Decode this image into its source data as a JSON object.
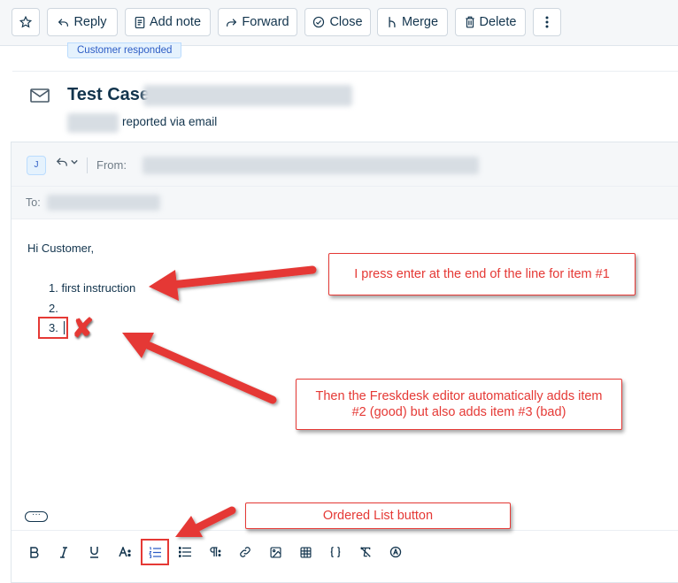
{
  "toolbar": {
    "reply_label": "Reply",
    "add_note_label": "Add note",
    "forward_label": "Forward",
    "close_label": "Close",
    "merge_label": "Merge",
    "delete_label": "Delete"
  },
  "ticket": {
    "status_badge": "Customer responded",
    "title": "Test Case",
    "source_text": "reported via email"
  },
  "editor": {
    "avatar_initial": "J",
    "from_label": "From:",
    "to_label": "To:",
    "greeting": "Hi Customer,",
    "list_items": [
      "1. first instruction",
      "2.",
      "3."
    ],
    "more_label": "···"
  },
  "annotations": {
    "callout_enter": "I press enter at the end of the line for item #1",
    "callout_auto": "Then the Freskdesk editor automatically adds item #2 (good) but also adds item #3 (bad)",
    "callout_ordered": "Ordered List button",
    "color": "#e53935"
  }
}
